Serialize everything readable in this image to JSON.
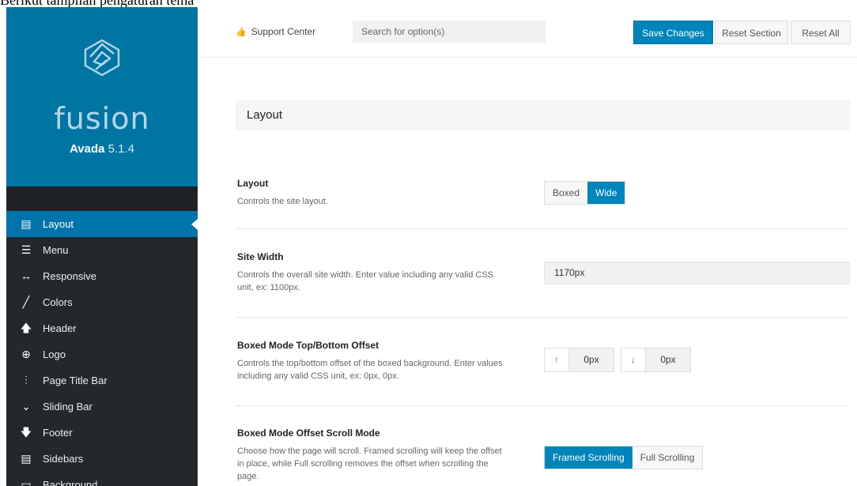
{
  "caption": "Berikut tampilan pengaturan tema di Avada:",
  "brand": {
    "logo_text": "fusion",
    "product": "Avada",
    "version": "5.1.4"
  },
  "sidebar": {
    "items": [
      {
        "label": "Layout",
        "icon": "layout-icon",
        "glyph": "▤"
      },
      {
        "label": "Menu",
        "icon": "menu-icon",
        "glyph": "☰"
      },
      {
        "label": "Responsive",
        "icon": "arrows-horizontal-icon",
        "glyph": "↔"
      },
      {
        "label": "Colors",
        "icon": "brush-icon",
        "glyph": "╱"
      },
      {
        "label": "Header",
        "icon": "arrow-up-icon",
        "glyph": "🡅"
      },
      {
        "label": "Logo",
        "icon": "plus-circle-icon",
        "glyph": "⊕"
      },
      {
        "label": "Page Title Bar",
        "icon": "sliders-icon",
        "glyph": "⫶"
      },
      {
        "label": "Sliding Bar",
        "icon": "chevron-down-icon",
        "glyph": "⌄"
      },
      {
        "label": "Footer",
        "icon": "arrow-down-icon",
        "glyph": "🡇"
      },
      {
        "label": "Sidebars",
        "icon": "sidebars-icon",
        "glyph": "▤"
      },
      {
        "label": "Background",
        "icon": "background-icon",
        "glyph": "▭"
      }
    ],
    "active_index": 0
  },
  "toolbar": {
    "support_label": "Support Center",
    "support_icon": "thumbs-up-icon",
    "search_placeholder": "Search for option(s)",
    "save_label": "Save Changes",
    "reset_section_label": "Reset Section",
    "reset_all_label": "Reset All"
  },
  "section": {
    "title": "Layout"
  },
  "options": {
    "layout": {
      "label": "Layout",
      "desc": "Controls the site layout.",
      "choices": [
        "Boxed",
        "Wide"
      ],
      "selected": "Wide"
    },
    "site_width": {
      "label": "Site Width",
      "desc": "Controls the overall site width. Enter value including any valid CSS unit, ex: 1100px.",
      "value": "1170px"
    },
    "boxed_offset": {
      "label": "Boxed Mode Top/Bottom Offset",
      "desc": "Controls the top/bottom offset of the boxed background. Enter values including any valid CSS unit, ex: 0px, 0px.",
      "top_icon": "↑",
      "top_value": "0px",
      "bottom_icon": "↓",
      "bottom_value": "0px"
    },
    "scroll_mode": {
      "label": "Boxed Mode Offset Scroll Mode",
      "desc": "Choose how the page will scroll. Framed scrolling will keep the offset in place, while Full scrolling removes the offset when scrolling the page.",
      "choices": [
        "Framed Scrolling",
        "Full Scrolling"
      ],
      "selected": "Framed Scrolling"
    }
  },
  "colors": {
    "brand_blue": "#0074a2",
    "accent": "#0085ba",
    "sidebar_bg": "#23282d"
  }
}
